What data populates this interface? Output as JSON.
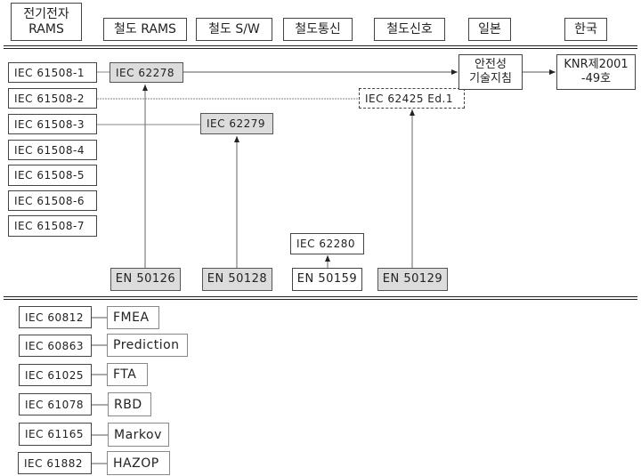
{
  "headers": [
    {
      "id": "elec",
      "label": "전기전자\nRAMS"
    },
    {
      "id": "rail-rams",
      "label": "철도 RAMS"
    },
    {
      "id": "rail-sw",
      "label": "철도 S/W"
    },
    {
      "id": "rail-comm",
      "label": "철도통신"
    },
    {
      "id": "rail-signal",
      "label": "철도신호"
    },
    {
      "id": "japan",
      "label": "일본"
    },
    {
      "id": "korea",
      "label": "한국"
    }
  ],
  "iec61508_parts": [
    "IEC 61508-1",
    "IEC 61508-2",
    "IEC 61508-3",
    "IEC 61508-4",
    "IEC 61508-5",
    "IEC 61508-6",
    "IEC 61508-7"
  ],
  "iec_standards": {
    "iec62278": "IEC 62278",
    "iec62279": "IEC 62279",
    "iec62280": "IEC 62280",
    "iec62425": "IEC 62425 Ed.1"
  },
  "en_standards": {
    "en50126": "EN 50126",
    "en50128": "EN 50128",
    "en50159": "EN 50159",
    "en50129": "EN 50129"
  },
  "japan": {
    "label": "안전성\n기술지침"
  },
  "korea": {
    "label": "KNR제2001\n-49호"
  },
  "methods": [
    {
      "standard": "IEC 60812",
      "method": "FMEA"
    },
    {
      "standard": "IEC 60863",
      "method": "Prediction"
    },
    {
      "standard": "IEC 61025",
      "method": "FTA"
    },
    {
      "standard": "IEC 61078",
      "method": "RBD"
    },
    {
      "standard": "IEC 61165",
      "method": "Markov"
    },
    {
      "standard": "IEC 61882",
      "method": "HAZOP"
    }
  ]
}
